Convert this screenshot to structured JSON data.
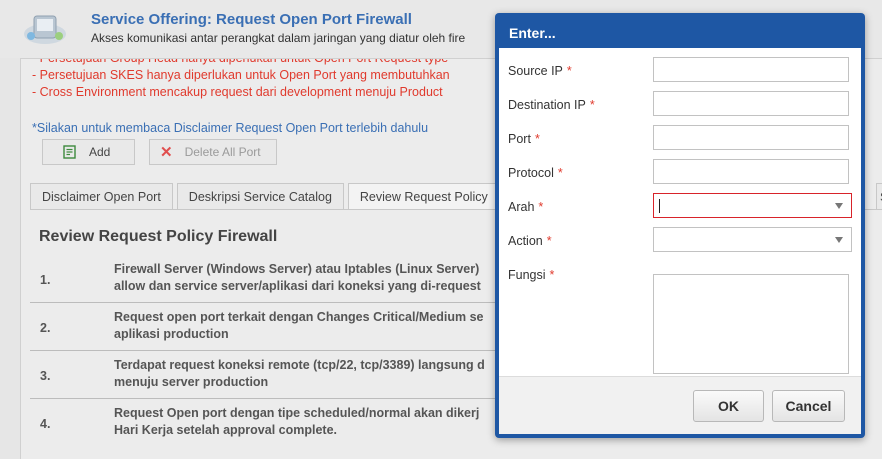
{
  "header": {
    "title": "Service Offering: Request Open Port Firewall",
    "subtitle": "Akses komunikasi antar perangkat dalam jaringan yang diatur oleh fire"
  },
  "notes": {
    "cut_line": "- Persetujuan Group Head hanya diperlukan untuk Open Port Request type",
    "line1": "- Persetujuan SKES hanya diperlukan untuk Open Port yang membutuhkan",
    "line2": "- Cross Environment mencakup request dari development menuju Product"
  },
  "disclaimer_link": "*Silakan untuk membaca Disclaimer Request Open Port terlebih dahulu",
  "toolbar": {
    "add_label": "Add",
    "delete_all_label": "Delete All Port"
  },
  "tabs": [
    {
      "label": "Disclaimer Open Port"
    },
    {
      "label": "Deskripsi Service Catalog"
    },
    {
      "label": "Review Request Policy"
    }
  ],
  "tab_edge_label": "S",
  "content": {
    "title": "Review Request Policy Firewall",
    "rows": [
      {
        "num": "1.",
        "line1": "Firewall Server (Windows Server) atau Iptables (Linux Server)",
        "line2": "allow dan service server/aplikasi dari koneksi yang di-request"
      },
      {
        "num": "2.",
        "line1": "Request open port terkait dengan Changes Critical/Medium se",
        "line2": "aplikasi production"
      },
      {
        "num": "3.",
        "line1": "Terdapat request koneksi remote (tcp/22, tcp/3389) langsung d",
        "line2": "menuju server production"
      },
      {
        "num": "4.",
        "line1": "Request Open port dengan tipe scheduled/normal akan dikerj",
        "line2": "Hari Kerja setelah approval complete."
      }
    ]
  },
  "dialog": {
    "title": "Enter...",
    "required_mark": "*",
    "fields": {
      "source_ip": {
        "label": "Source IP",
        "value": ""
      },
      "destination_ip": {
        "label": "Destination IP",
        "value": ""
      },
      "port": {
        "label": "Port",
        "value": ""
      },
      "protocol": {
        "label": "Protocol",
        "value": ""
      },
      "arah": {
        "label": "Arah",
        "value": ""
      },
      "action": {
        "label": "Action",
        "value": ""
      },
      "fungsi": {
        "label": "Fungsi",
        "value": ""
      }
    },
    "ok_label": "OK",
    "cancel_label": "Cancel"
  },
  "colors": {
    "dialog_header": "#1e57a4",
    "title_blue": "#3a6fb4",
    "note_red": "#e03a2d",
    "error_border": "#d8232a"
  }
}
